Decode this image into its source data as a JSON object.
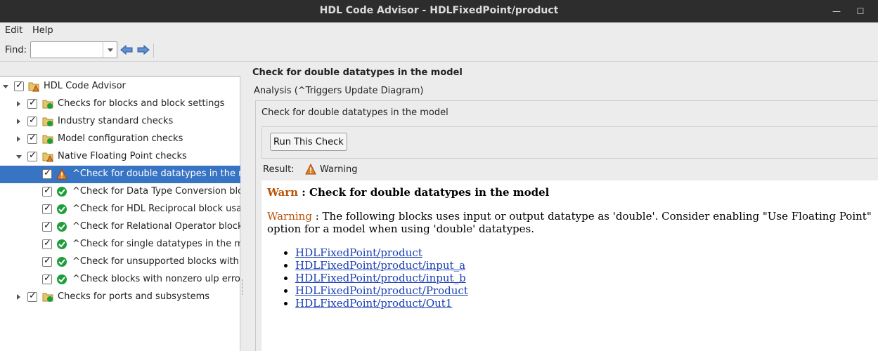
{
  "window": {
    "title": "HDL Code Advisor - HDLFixedPoint/product",
    "minimize_glyph": "—",
    "maximize_glyph": "☐"
  },
  "menu": {
    "edit": "Edit",
    "help": "Help"
  },
  "find": {
    "label": "Find:",
    "value": ""
  },
  "tree": {
    "root": {
      "label": "HDL Code Advisor",
      "icon": "folder-warning-icon"
    },
    "items": [
      {
        "label": "Checks for blocks and block settings",
        "icon": "folder-pass-icon",
        "expanded": false
      },
      {
        "label": "Industry standard checks",
        "icon": "folder-pass-icon",
        "expanded": false
      },
      {
        "label": "Model configuration checks",
        "icon": "folder-pass-icon",
        "expanded": false
      },
      {
        "label": "Native Floating Point checks",
        "icon": "folder-warning-icon",
        "expanded": true,
        "children": [
          {
            "label": "^Check for double datatypes in the m",
            "icon": "warning-icon",
            "selected": true
          },
          {
            "label": "^Check for Data Type Conversion blo",
            "icon": "pass-icon"
          },
          {
            "label": "^Check for HDL Reciprocal block usa",
            "icon": "pass-icon"
          },
          {
            "label": "^Check for Relational Operator block",
            "icon": "pass-icon"
          },
          {
            "label": "^Check for single datatypes in the m",
            "icon": "pass-icon"
          },
          {
            "label": "^Check for unsupported blocks with",
            "icon": "pass-icon"
          },
          {
            "label": "^Check blocks with nonzero ulp erro",
            "icon": "pass-icon"
          }
        ]
      },
      {
        "label": "Checks for ports and subsystems",
        "icon": "folder-pass-icon",
        "expanded": false
      }
    ]
  },
  "detail": {
    "title": "Check for double datatypes in the model",
    "analysis": "Analysis (^Triggers Update Diagram)",
    "box_title": "Check for double datatypes in the model",
    "run_button": "Run This Check",
    "result_label": "Result:",
    "result_value": "Warning",
    "report": {
      "heading_tag": "Warn",
      "heading_text": " : Check for double datatypes in the model",
      "para_tag": "Warning",
      "para_text": " : The following blocks uses input or output datatype as 'double'. Consider enabling \"Use Floating Point\" option for a model when using 'double' datatypes.",
      "links": [
        "HDLFixedPoint/product",
        "HDLFixedPoint/product/input_a",
        "HDLFixedPoint/product/input_b",
        "HDLFixedPoint/product/Product",
        "HDLFixedPoint/product/Out1"
      ]
    },
    "colors": {
      "warn": "#b8540a",
      "link": "#1a3fb3",
      "selection": "#3874c4",
      "pass": "#1e9e3a"
    }
  }
}
